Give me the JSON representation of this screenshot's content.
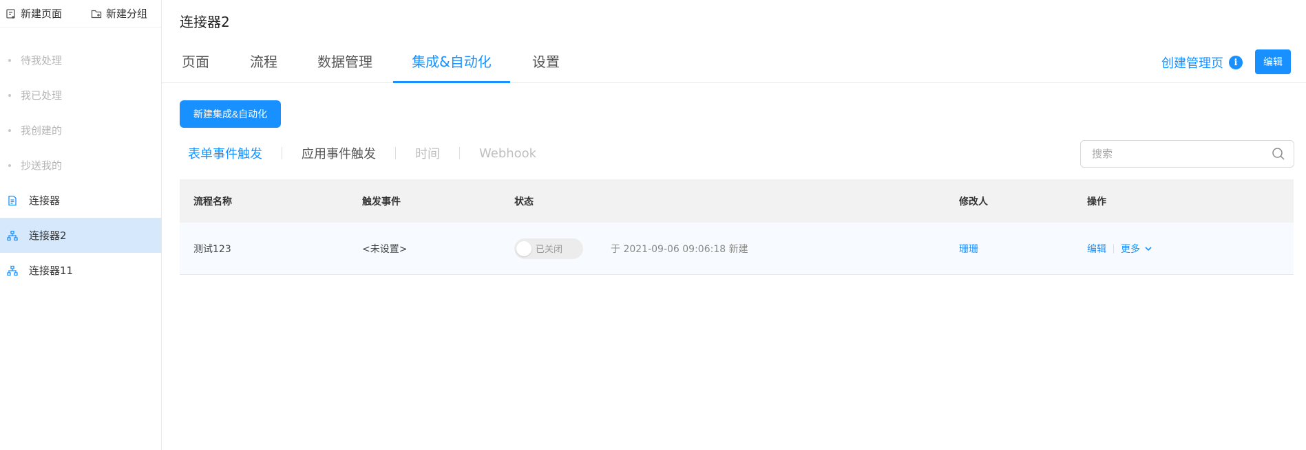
{
  "sidebar": {
    "new_page": "新建页面",
    "new_group": "新建分组",
    "items": [
      {
        "label": "待我处理"
      },
      {
        "label": "我已处理"
      },
      {
        "label": "我创建的"
      },
      {
        "label": "抄送我的"
      },
      {
        "label": "连接器"
      },
      {
        "label": "连接器2"
      },
      {
        "label": "连接器11"
      }
    ]
  },
  "header": {
    "title": "连接器2",
    "tabs": [
      {
        "label": "页面"
      },
      {
        "label": "流程"
      },
      {
        "label": "数据管理"
      },
      {
        "label": "集成&自动化"
      },
      {
        "label": "设置"
      }
    ],
    "create_manage_page": "创建管理页",
    "edit_button": "编辑"
  },
  "toolbar": {
    "new_button": "新建集成&自动化",
    "subtabs": [
      {
        "label": "表单事件触发"
      },
      {
        "label": "应用事件触发"
      },
      {
        "label": "时间"
      },
      {
        "label": "Webhook"
      }
    ],
    "search_placeholder": "搜索"
  },
  "table": {
    "columns": [
      "流程名称",
      "触发事件",
      "状态",
      "修改人",
      "操作"
    ],
    "rows": [
      {
        "name": "测试123",
        "trigger": "<未设置>",
        "status": "已关闭",
        "created": "于 2021-09-06 09:06:18 新建",
        "modifier": "珊珊",
        "op_edit": "编辑",
        "op_more": "更多"
      }
    ]
  },
  "colors": {
    "accent": "#1890ff",
    "active_sidebar_bg": "#d6e9fc"
  }
}
